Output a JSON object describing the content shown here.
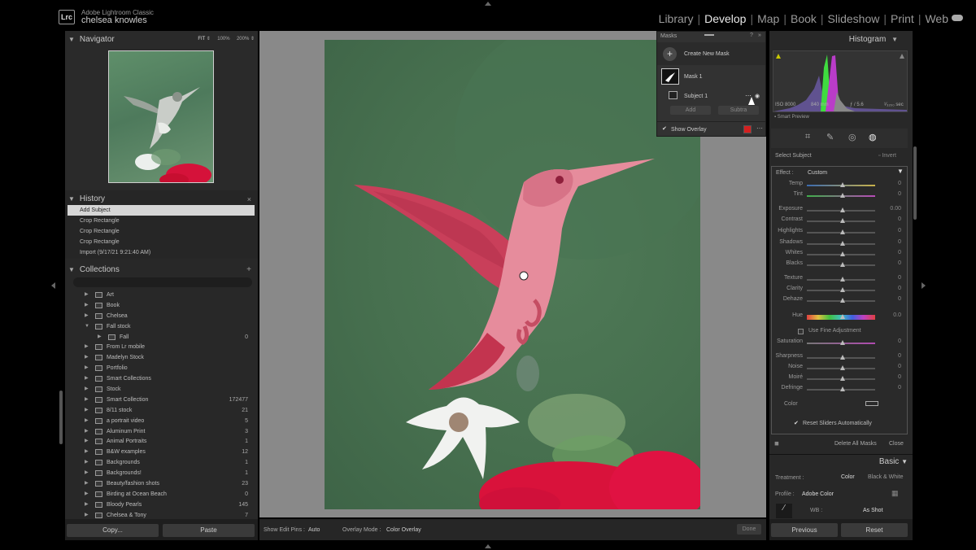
{
  "top": {
    "logo": "Lrc",
    "app_name": "Adobe Lightroom Classic",
    "user": "chelsea knowles",
    "modules": [
      "Library",
      "Develop",
      "Map",
      "Book",
      "Slideshow",
      "Print",
      "Web"
    ],
    "active_module": "Develop"
  },
  "left": {
    "navigator": {
      "title": "Navigator",
      "fit": "FIT",
      "z1": "100%",
      "z2": "200%"
    },
    "history": {
      "title": "History",
      "items": [
        "Add Subject",
        "Crop Rectangle",
        "Crop Rectangle",
        "Crop Rectangle",
        "Import (9/17/21 9:21:40 AM)"
      ]
    },
    "collections": {
      "title": "Collections",
      "items": [
        {
          "name": "Art",
          "count": ""
        },
        {
          "name": "Book",
          "count": ""
        },
        {
          "name": "Chelsea",
          "count": ""
        },
        {
          "name": "Fall stock",
          "count": ""
        },
        {
          "name": "Fall",
          "count": "0"
        },
        {
          "name": "From Lr mobile",
          "count": ""
        },
        {
          "name": "Madelyn Stock",
          "count": ""
        },
        {
          "name": "Portfolio",
          "count": ""
        },
        {
          "name": "Smart Collections",
          "count": ""
        },
        {
          "name": "Stock",
          "count": ""
        },
        {
          "name": "Smart Collection",
          "count": "172477"
        },
        {
          "name": "8/11 stock",
          "count": "21"
        },
        {
          "name": "a portrait video",
          "count": "5"
        },
        {
          "name": "Aluminum Print",
          "count": "3"
        },
        {
          "name": "Animal Portraits",
          "count": "1"
        },
        {
          "name": "B&W examples",
          "count": "12"
        },
        {
          "name": "Backgrounds",
          "count": "1"
        },
        {
          "name": "Backgrounds!",
          "count": "1"
        },
        {
          "name": "Beauty/fashion shots",
          "count": "23"
        },
        {
          "name": "Birding at Ocean Beach",
          "count": "0"
        },
        {
          "name": "Bloody Pearls",
          "count": "145"
        },
        {
          "name": "Chelsea & Tony",
          "count": "7"
        }
      ]
    },
    "copy": "Copy...",
    "paste": "Paste"
  },
  "toolbar": {
    "edit_pins_label": "Show Edit Pins :",
    "edit_pins_value": "Auto",
    "overlay_label": "Overlay Mode :",
    "overlay_value": "Color Overlay",
    "done": "Done"
  },
  "masks": {
    "title": "Masks",
    "create": "Create New Mask",
    "mask1": "Mask 1",
    "subject1": "Subject 1",
    "add": "Add",
    "subtract": "Subtra",
    "show_overlay": "Show Overlay",
    "overlay_color": "#d42020"
  },
  "right": {
    "histogram": {
      "title": "Histogram",
      "iso": "ISO 8000",
      "focal": "840 mm",
      "aperture": "ƒ / 5.6",
      "shutter": "¹⁄₃₂₀₀ sec",
      "smart_preview": "Smart Preview"
    },
    "select_subject": "Select Subject",
    "invert": "Invert",
    "effect_label": "Effect :",
    "effect_value": "Custom",
    "sliders": [
      {
        "label": "Temp",
        "value": "0"
      },
      {
        "label": "Tint",
        "value": "0"
      },
      {
        "label": "Exposure",
        "value": "0.00"
      },
      {
        "label": "Contrast",
        "value": "0"
      },
      {
        "label": "Highlights",
        "value": "0"
      },
      {
        "label": "Shadows",
        "value": "0"
      },
      {
        "label": "Whites",
        "value": "0"
      },
      {
        "label": "Blacks",
        "value": "0"
      },
      {
        "label": "Texture",
        "value": "0"
      },
      {
        "label": "Clarity",
        "value": "0"
      },
      {
        "label": "Dehaze",
        "value": "0"
      },
      {
        "label": "Hue",
        "value": "0.0"
      },
      {
        "label": "Saturation",
        "value": "0"
      },
      {
        "label": "Sharpness",
        "value": "0"
      },
      {
        "label": "Noise",
        "value": "0"
      },
      {
        "label": "Moiré",
        "value": "0"
      },
      {
        "label": "Defringe",
        "value": "0"
      }
    ],
    "fine_adjust": "Use Fine Adjustment",
    "color_label": "Color",
    "reset_auto": "Reset Sliders Automatically",
    "delete_all": "Delete All Masks",
    "close": "Close",
    "basic": "Basic",
    "treatment_label": "Treatment :",
    "treatment_color": "Color",
    "treatment_bw": "Black & White",
    "profile_label": "Profile :",
    "profile_value": "Adobe Color",
    "wb_label": "WB :",
    "wb_value": "As Shot",
    "previous": "Previous",
    "reset": "Reset"
  }
}
